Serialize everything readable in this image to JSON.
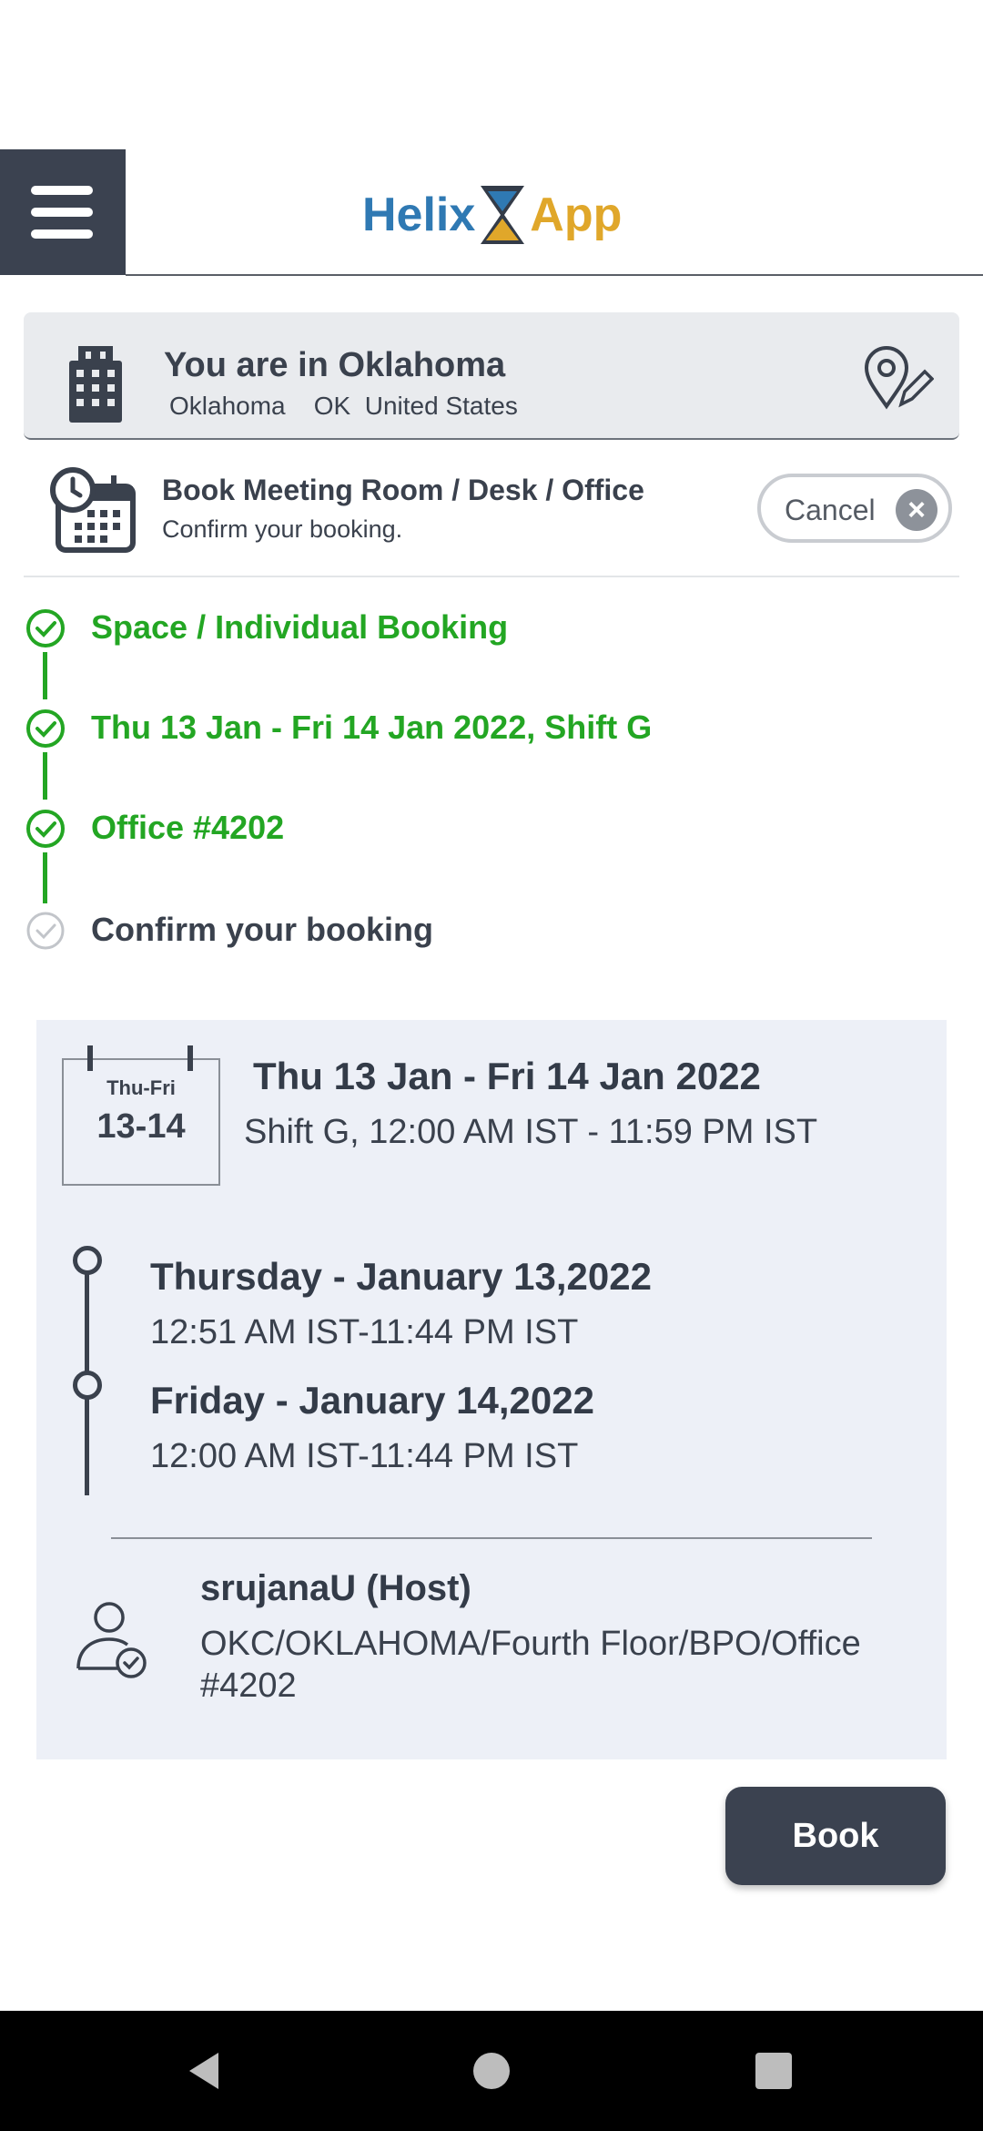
{
  "header": {
    "logo_left": "Helix",
    "logo_right": "App"
  },
  "location": {
    "title": "You are in Oklahoma",
    "subtitle": "Oklahoma    OK  United States"
  },
  "booking": {
    "title": "Book Meeting Room / Desk / Office",
    "subtitle": "Confirm your booking.",
    "cancel_label": "Cancel"
  },
  "steps": [
    {
      "label": "Space / Individual Booking",
      "status": "done"
    },
    {
      "label": "Thu 13 Jan - Fri 14 Jan 2022, Shift G",
      "status": "done"
    },
    {
      "label": "Office #4202",
      "status": "done"
    },
    {
      "label": "Confirm your booking",
      "status": "pending"
    }
  ],
  "summary": {
    "calendar_days": "Thu-Fri",
    "calendar_dates": "13-14",
    "range_title": "Thu 13 Jan - Fri 14 Jan 2022",
    "range_shift": "Shift G, 12:00 AM IST - 11:59 PM IST",
    "days": [
      {
        "title": "Thursday - January 13,2022",
        "time": "12:51 AM IST-11:44 PM IST"
      },
      {
        "title": "Friday - January 14,2022",
        "time": "12:00 AM IST-11:44 PM IST"
      }
    ],
    "host_name": "srujanaU (Host)",
    "host_location": "OKC/OKLAHOMA/Fourth Floor/BPO/Office #4202"
  },
  "actions": {
    "book_label": "Book"
  },
  "colors": {
    "accent_dark": "#3b4250",
    "done_green": "#23a623",
    "logo_blue": "#2f79b3",
    "logo_gold": "#e0a72a",
    "card_bg": "#edf0f7"
  }
}
